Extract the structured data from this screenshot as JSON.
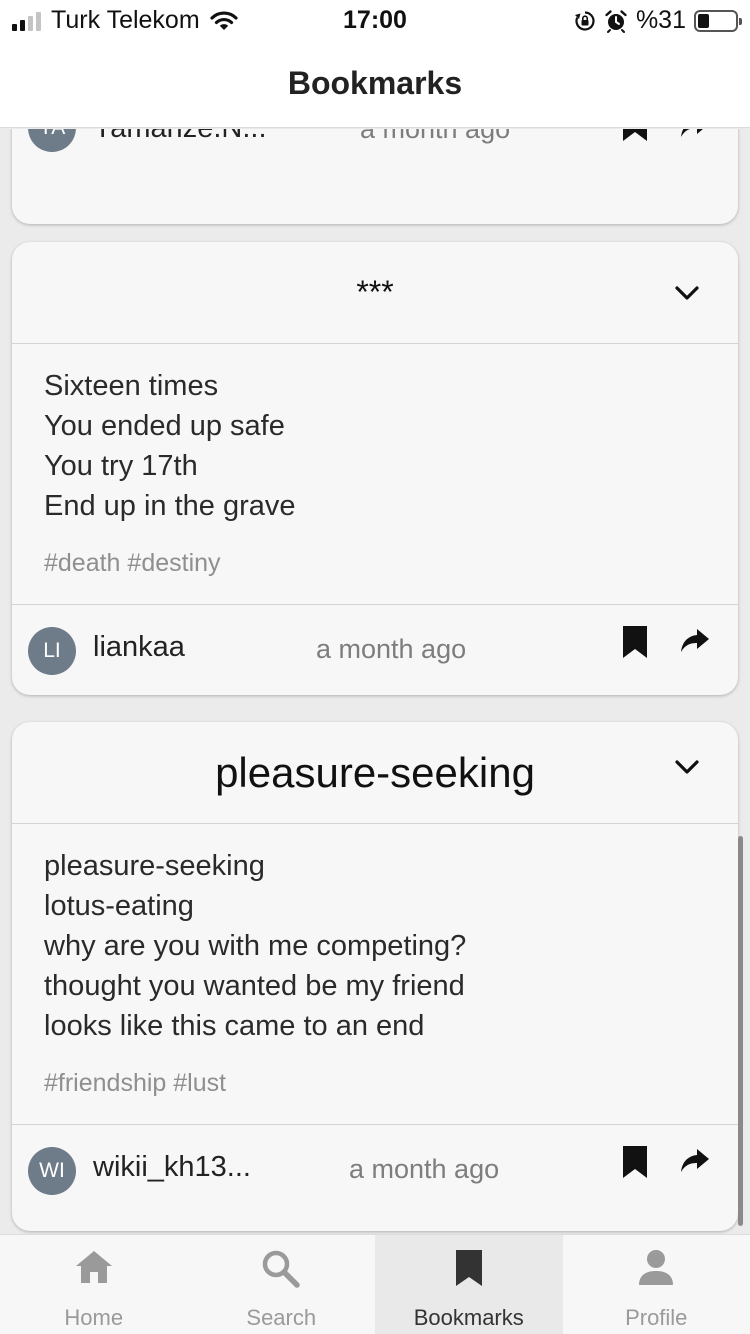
{
  "status_bar": {
    "carrier": "Turk Telekom",
    "time": "17:00",
    "battery_text": "%31",
    "battery_level": 0.31
  },
  "header": {
    "title": "Bookmarks"
  },
  "cards": [
    {
      "author": {
        "initials": "YA",
        "name": "Yamarize.N...",
        "time": "a month ago"
      }
    },
    {
      "title": "***",
      "lines": [
        "Sixteen times",
        "You ended up safe",
        "You try 17th",
        "End up in the grave"
      ],
      "tags": "#death #destiny",
      "author": {
        "initials": "LI",
        "name": "liankaa",
        "time": "a month ago"
      }
    },
    {
      "title": "pleasure-seeking",
      "lines": [
        "pleasure-seeking",
        "lotus-eating",
        "why are you with me competing?",
        "thought you wanted be my friend",
        "looks like this came to an end"
      ],
      "tags": "#friendship #lust",
      "author": {
        "initials": "WI",
        "name": "wikii_kh13...",
        "time": "a month ago"
      }
    }
  ],
  "tabs": [
    {
      "label": "Home",
      "icon": "home-icon",
      "active": false
    },
    {
      "label": "Search",
      "icon": "search-icon",
      "active": false
    },
    {
      "label": "Bookmarks",
      "icon": "bookmark-icon",
      "active": true
    },
    {
      "label": "Profile",
      "icon": "profile-icon",
      "active": false
    }
  ],
  "colors": {
    "avatar": "#6e7b88",
    "tab_inactive": "#9a9a9a",
    "tab_active": "#333333"
  }
}
